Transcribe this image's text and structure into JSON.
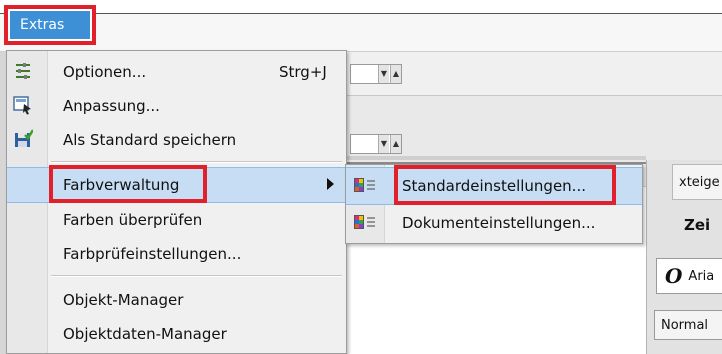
{
  "menubar": {
    "extras_label": "Extras"
  },
  "menu": {
    "items": [
      {
        "label": "Optionen...",
        "shortcut": "Strg+J",
        "icon": "options-icon"
      },
      {
        "label": "Anpassung...",
        "icon": "customize-icon"
      },
      {
        "label": "Als Standard speichern",
        "icon": "save-default-icon"
      },
      {
        "label": "Farbverwaltung",
        "icon": "",
        "submenu": true,
        "highlighted": true
      },
      {
        "label": "Farben überprüfen"
      },
      {
        "label": "Farbprüfeinstellungen..."
      },
      {
        "label": "Objekt-Manager"
      },
      {
        "label": "Objektdaten-Manager"
      }
    ]
  },
  "submenu": {
    "items": [
      {
        "label": "Standardeinstellungen...",
        "icon": "color-settings-icon",
        "highlighted": true
      },
      {
        "label": "Dokumenteinstellungen...",
        "icon": "color-settings-icon"
      }
    ]
  },
  "background": {
    "tab_label": "xteige",
    "heading": "Zei",
    "font_glyph": "O",
    "font_name": "Aria",
    "style_value": "Normal"
  },
  "colors": {
    "highlight": "#c6ddf4",
    "annotation_red": "#e0202a",
    "menubar_active": "#3d8fd6"
  }
}
